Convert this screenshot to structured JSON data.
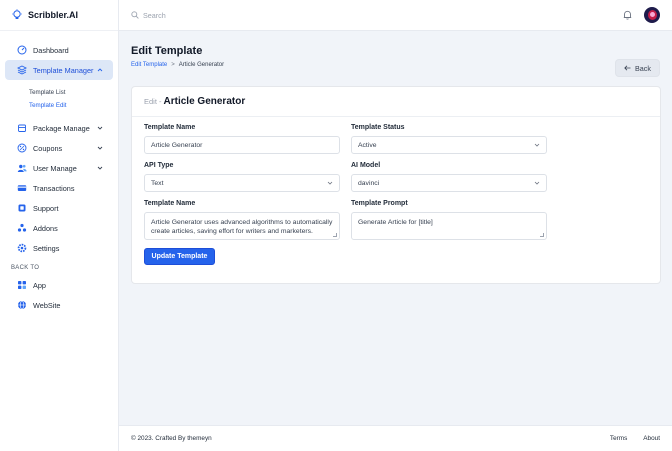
{
  "brand": {
    "name": "Scribbler.AI"
  },
  "search": {
    "placeholder": "Search"
  },
  "sidebar": {
    "items": [
      {
        "label": "Dashboard"
      },
      {
        "label": "Template Manager"
      },
      {
        "label": "Package Manage"
      },
      {
        "label": "Coupons"
      },
      {
        "label": "User Manage"
      },
      {
        "label": "Transactions"
      },
      {
        "label": "Support"
      },
      {
        "label": "Addons"
      },
      {
        "label": "Settings"
      }
    ],
    "sub_items": [
      {
        "label": "Template List"
      },
      {
        "label": "Template Edit"
      }
    ],
    "back_section_label": "BACK TO",
    "back_items": [
      {
        "label": "App"
      },
      {
        "label": "WebSite"
      }
    ]
  },
  "page": {
    "title": "Edit Template",
    "breadcrumb": {
      "link": "Edit Template",
      "separator": ">",
      "current": "Article Generator"
    },
    "back_label": "Back"
  },
  "card": {
    "prefix": "Edit -",
    "title": "Article Generator"
  },
  "form": {
    "template_name_label": "Template Name",
    "template_name_value": "Article Generator",
    "template_status_label": "Template Status",
    "template_status_value": "Active",
    "api_type_label": "API Type",
    "api_type_value": "Text",
    "ai_model_label": "AI Model",
    "ai_model_value": "davinci",
    "description_label": "Template Name",
    "description_value": "Article Generator uses advanced algorithms to automatically create articles, saving effort for writers and marketers.",
    "prompt_label": "Template Prompt",
    "prompt_value": "Generate Article for [title]",
    "submit_label": "Update Template"
  },
  "footer": {
    "copyright": "© 2023. Crafted By themeyn",
    "terms": "Terms",
    "about": "About"
  },
  "colors": {
    "accent": "#2563eb",
    "active_bg": "#dde7f7",
    "page_bg": "#f1f4f9"
  }
}
